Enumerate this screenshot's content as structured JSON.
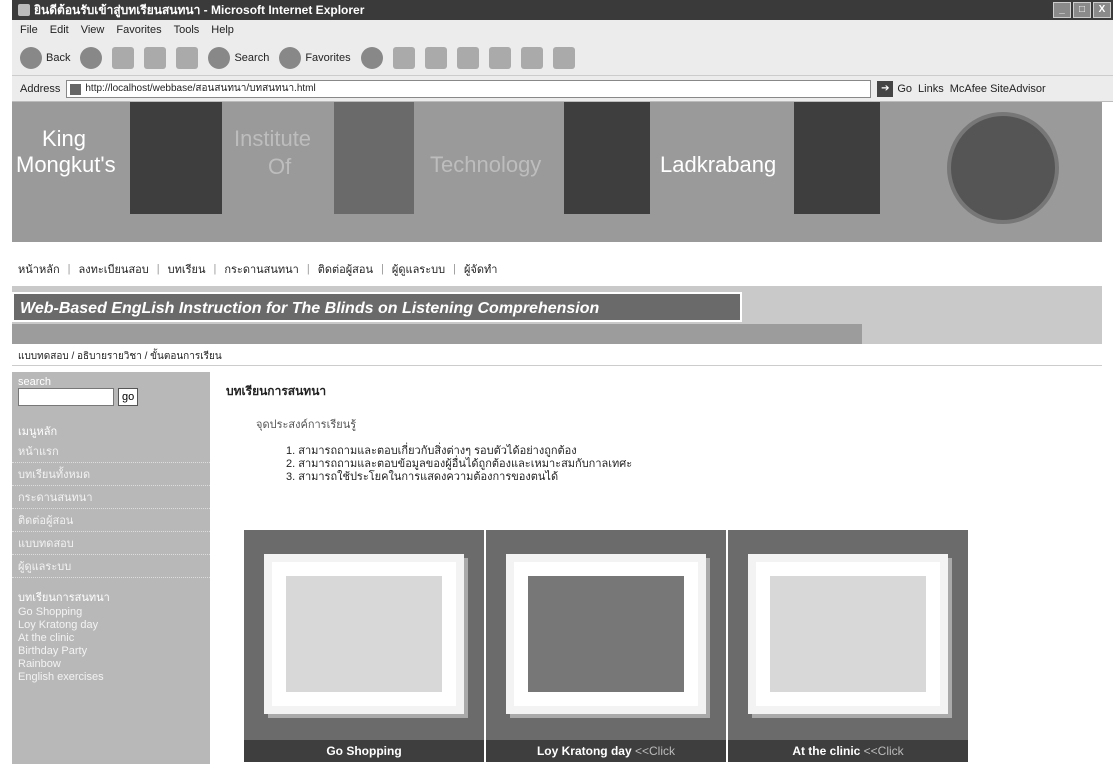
{
  "window": {
    "title": "ยินดีต้อนรับเข้าสู่บทเรียนสนทนา - Microsoft Internet Explorer",
    "min_label": "_",
    "max_label": "□",
    "close_label": "X"
  },
  "menubar": {
    "items": [
      "File",
      "Edit",
      "View",
      "Favorites",
      "Tools",
      "Help"
    ]
  },
  "toolbar": {
    "back_label": "Back",
    "search_label": "Search",
    "favorites_label": "Favorites"
  },
  "address": {
    "label": "Address",
    "url": "http://localhost/webbase/สอนสนทนา/บทสนทนา.html",
    "go_label": "Go",
    "links_label": "Links",
    "mcafee_label": "McAfee SiteAdvisor"
  },
  "banner": {
    "word1": "King",
    "word2": "Mongkut's",
    "word3": "Institute",
    "word4": "Of",
    "word5": "Technology",
    "word6": "Ladkrabang"
  },
  "topnav": {
    "items": [
      "หน้าหลัก",
      "ลงทะเบียนสอบ",
      "บทเรียน",
      "กระดานสนทนา",
      "ติดต่อผู้สอน",
      "ผู้ดูแลระบบ",
      "ผู้จัดทำ"
    ]
  },
  "title_banner": {
    "text": "Web-Based EngLish Instruction for The Blinds on Listening Comprehension"
  },
  "subnav": {
    "items": [
      "แบบทดสอบ",
      "อธิบายรายวิชา",
      "ขั้นตอนการเรียน"
    ]
  },
  "sidebar": {
    "search_heading": "search",
    "search_button": "go",
    "menu_heading": "เมนูหลัก",
    "menu_items": [
      "หน้าแรก",
      "บทเรียนทั้งหมด",
      "กระดานสนทนา",
      "ติดต่อผู้สอน",
      "แบบทดสอบ",
      "ผู้ดูแลระบบ"
    ],
    "lessons_heading": "บทเรียนการสนทนา",
    "lessons": [
      "Go Shopping",
      "Loy Kratong day",
      "At the clinic",
      "Birthday Party",
      "Rainbow",
      "English exercises"
    ]
  },
  "main": {
    "heading": "บทเรียนการสนทนา",
    "objectives_heading": "จุดประสงค์การเรียนรู้",
    "objectives": [
      "1. สามารถถามและตอบเกี่ยวกับสิ่งต่างๆ รอบตัวได้อย่างถูกต้อง",
      "2. สามารถถามและตอบข้อมูลของผู้อื่นได้ถูกต้องและเหมาะสมกับกาลเทศะ",
      "3. สามารถใช้ประโยคในการแสดงความต้องการของตนได้"
    ]
  },
  "cards": [
    {
      "title": "Go Shopping",
      "click": ""
    },
    {
      "title": "Loy Kratong day",
      "click": " <<Click"
    },
    {
      "title": "At the clinic",
      "click": " <<Click"
    }
  ]
}
